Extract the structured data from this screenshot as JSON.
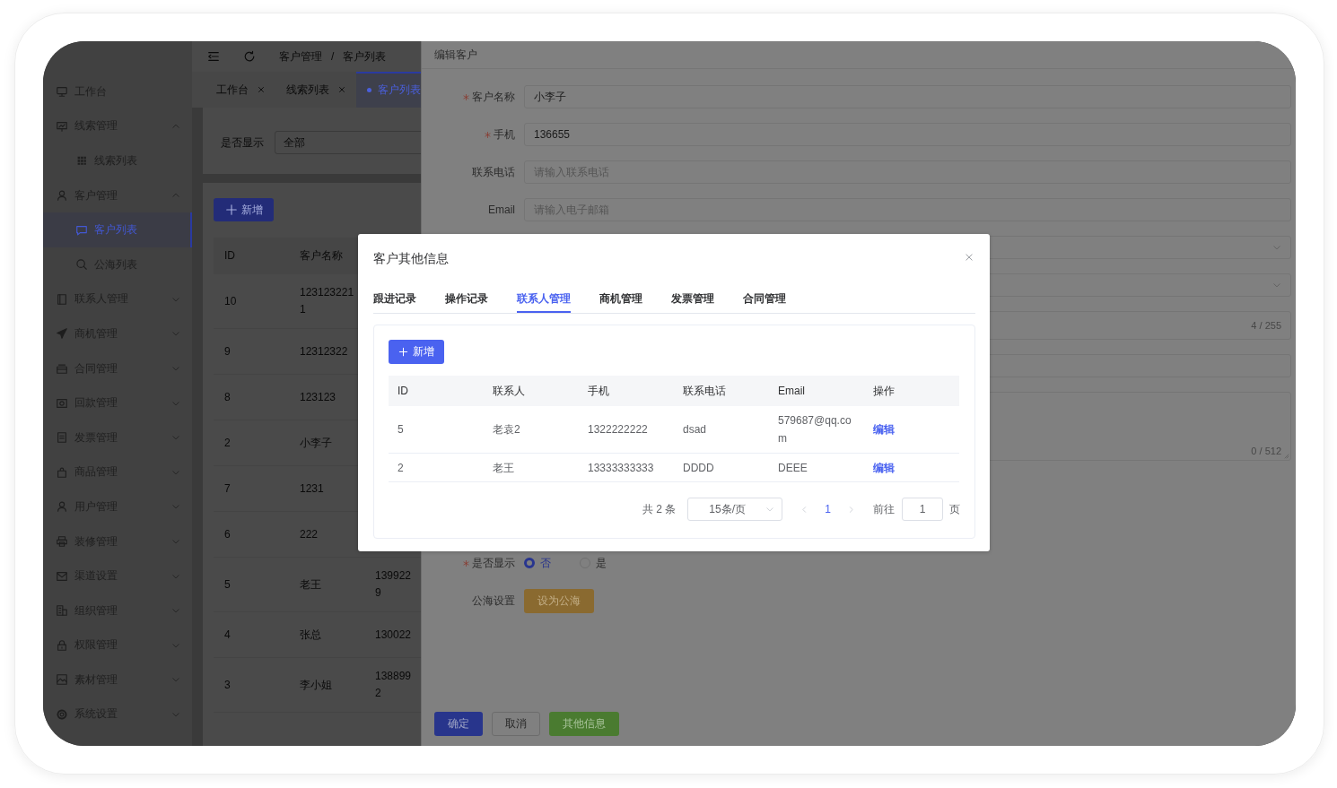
{
  "sidebar": {
    "items": [
      {
        "label": "工作台",
        "selected": false
      },
      {
        "label": "线索管理",
        "selected": false,
        "expanded": true,
        "children": [
          {
            "label": "线索列表",
            "selected": false
          }
        ]
      },
      {
        "label": "客户管理",
        "selected": false,
        "expanded": true,
        "children": [
          {
            "label": "客户列表",
            "selected": true
          },
          {
            "label": "公海列表",
            "selected": false
          }
        ]
      },
      {
        "label": "联系人管理",
        "selected": false,
        "expanded": false
      },
      {
        "label": "商机管理",
        "selected": false,
        "expanded": false
      },
      {
        "label": "合同管理",
        "selected": false,
        "expanded": false
      },
      {
        "label": "回款管理",
        "selected": false,
        "expanded": false
      },
      {
        "label": "发票管理",
        "selected": false,
        "expanded": false
      },
      {
        "label": "商品管理",
        "selected": false,
        "expanded": false
      },
      {
        "label": "用户管理",
        "selected": false,
        "expanded": false
      },
      {
        "label": "装修管理",
        "selected": false,
        "expanded": false
      },
      {
        "label": "渠道设置",
        "selected": false,
        "expanded": false
      },
      {
        "label": "组织管理",
        "selected": false,
        "expanded": false
      },
      {
        "label": "权限管理",
        "selected": false,
        "expanded": false
      },
      {
        "label": "素材管理",
        "selected": false,
        "expanded": false
      },
      {
        "label": "系统设置",
        "selected": false,
        "expanded": false
      }
    ]
  },
  "top_bar": {
    "breadcrumb": [
      "客户管理",
      "客户列表"
    ],
    "separator": "/"
  },
  "tabs": [
    {
      "label": "工作台",
      "selected": false
    },
    {
      "label": "线索列表",
      "selected": false
    },
    {
      "label": "客户列表",
      "selected": true
    }
  ],
  "list_page": {
    "filter": {
      "label": "是否显示",
      "value": "全部"
    },
    "add_button": "新增",
    "table": {
      "columns": [
        "ID",
        "客户名称"
      ],
      "rows": [
        {
          "cells": [
            "10",
            "123123221\n1"
          ]
        },
        {
          "cells": [
            "9",
            "12312322"
          ]
        },
        {
          "cells": [
            "8",
            "123123"
          ]
        },
        {
          "cells": [
            "2",
            "小李子"
          ]
        },
        {
          "cells": [
            "7",
            "1231"
          ]
        },
        {
          "cells": [
            "6",
            "222"
          ]
        },
        {
          "cells": [
            "5",
            "老王",
            "139922\n9"
          ]
        },
        {
          "cells": [
            "4",
            "张总",
            "130022"
          ]
        },
        {
          "cells": [
            "3",
            "李小姐",
            "138899\n2"
          ]
        }
      ]
    }
  },
  "drawer": {
    "title": "编辑客户",
    "fields": [
      {
        "kind": "input",
        "label": "客户名称",
        "required": true,
        "value": "小李子"
      },
      {
        "kind": "input",
        "label": "手机",
        "required": true,
        "value": "136655"
      },
      {
        "kind": "input",
        "label": "联系电话",
        "placeholder": "请输入联系电话"
      },
      {
        "kind": "input",
        "label": "Email",
        "placeholder": "请输入电子邮箱"
      },
      {
        "kind": "select"
      },
      {
        "kind": "select"
      },
      {
        "kind": "counted",
        "counter": "4 / 255"
      },
      {
        "kind": "input"
      },
      {
        "kind": "textarea",
        "counter": "0 / 512"
      },
      {
        "kind": "radio",
        "label": "是否显示",
        "required": true,
        "options": [
          {
            "label": "否",
            "selected": true
          },
          {
            "label": "是",
            "selected": false
          }
        ]
      },
      {
        "kind": "button",
        "label": "公海设置",
        "button": "设为公海"
      }
    ],
    "footer": [
      {
        "label": "确定",
        "kind": "primary"
      },
      {
        "label": "取消",
        "kind": "default"
      },
      {
        "label": "其他信息",
        "kind": "success"
      }
    ]
  },
  "modal": {
    "title": "客户其他信息",
    "tabs": [
      {
        "label": "跟进记录",
        "selected": false
      },
      {
        "label": "操作记录",
        "selected": false
      },
      {
        "label": "联系人管理",
        "selected": true
      },
      {
        "label": "商机管理",
        "selected": false
      },
      {
        "label": "发票管理",
        "selected": false
      },
      {
        "label": "合同管理",
        "selected": false
      }
    ],
    "add_button": "新增",
    "table": {
      "columns": [
        "ID",
        "联系人",
        "手机",
        "联系电话",
        "Email",
        "操作"
      ],
      "rows": [
        {
          "cells": [
            "5",
            "老袁2",
            "1322222222",
            "dsad",
            "579687@qq.com"
          ],
          "action": "编辑"
        },
        {
          "cells": [
            "2",
            "老王",
            "13333333333",
            "DDDD",
            "DEEE"
          ],
          "action": "编辑"
        }
      ]
    },
    "pagination": {
      "total": "共 2 条",
      "page_size": "15条/页",
      "pages": [
        {
          "label": "1",
          "selected": true
        }
      ],
      "goto_label": "前往",
      "goto_value": "1",
      "page_suffix": "页"
    }
  }
}
